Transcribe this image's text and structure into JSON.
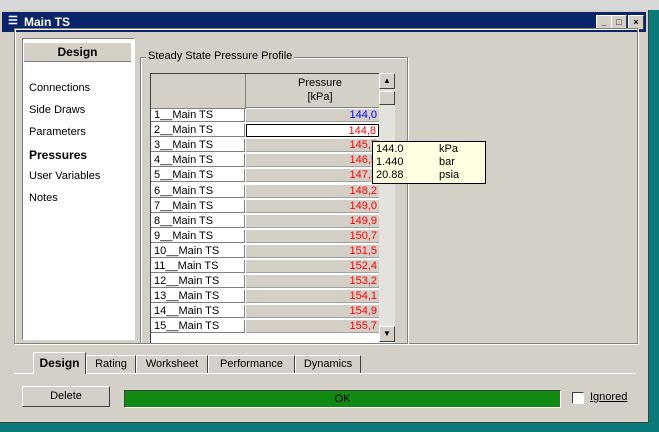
{
  "window": {
    "title": "Main TS",
    "icon_glyph": "☰",
    "minimize_glyph": "_",
    "maximize_glyph": "□",
    "close_glyph": "×"
  },
  "nav": {
    "heading": "Design",
    "items": [
      {
        "label": "Connections",
        "selected": false
      },
      {
        "label": "Side Draws",
        "selected": false
      },
      {
        "label": "Parameters",
        "selected": false
      },
      {
        "label": "Pressures",
        "selected": true
      },
      {
        "label": "User Variables",
        "selected": false
      },
      {
        "label": "Notes",
        "selected": false
      }
    ]
  },
  "profile": {
    "group_label": "Steady State Pressure Profile",
    "column_header": "Pressure",
    "column_unit": "[kPa]",
    "rows": [
      {
        "stage": "1__Main TS",
        "value": "144,0",
        "color": "#0000ff"
      },
      {
        "stage": "2__Main TS",
        "value": "144,8",
        "color": "#ff0000"
      },
      {
        "stage": "3__Main TS",
        "value": "145,7",
        "color": "#ff0000"
      },
      {
        "stage": "4__Main TS",
        "value": "146,5",
        "color": "#ff0000"
      },
      {
        "stage": "5__Main TS",
        "value": "147,3",
        "color": "#ff0000"
      },
      {
        "stage": "6__Main TS",
        "value": "148,2",
        "color": "#ff0000"
      },
      {
        "stage": "7__Main TS",
        "value": "149,0",
        "color": "#ff0000"
      },
      {
        "stage": "8__Main TS",
        "value": "149,9",
        "color": "#ff0000"
      },
      {
        "stage": "9__Main TS",
        "value": "150,7",
        "color": "#ff0000"
      },
      {
        "stage": "10__Main TS",
        "value": "151,5",
        "color": "#ff0000"
      },
      {
        "stage": "11__Main TS",
        "value": "152,4",
        "color": "#ff0000"
      },
      {
        "stage": "12__Main TS",
        "value": "153,2",
        "color": "#ff0000"
      },
      {
        "stage": "13__Main TS",
        "value": "154,1",
        "color": "#ff0000"
      },
      {
        "stage": "14__Main TS",
        "value": "154,9",
        "color": "#ff0000"
      },
      {
        "stage": "15__Main TS",
        "value": "155,7",
        "color": "#ff0000"
      }
    ],
    "selected_row": 1
  },
  "tooltip": {
    "lines": [
      {
        "value": "144.0",
        "unit": "kPa"
      },
      {
        "value": "1.440",
        "unit": "bar"
      },
      {
        "value": "20.88",
        "unit": "psia"
      }
    ]
  },
  "tabs": [
    {
      "label": "Design",
      "active": true
    },
    {
      "label": "Rating",
      "active": false
    },
    {
      "label": "Worksheet",
      "active": false
    },
    {
      "label": "Performance",
      "active": false
    },
    {
      "label": "Dynamics",
      "active": false
    }
  ],
  "footer": {
    "delete_label": "Delete",
    "status_text": "OK",
    "status_color": "#118a11",
    "ignored_label": "Ignored",
    "ignored_checked": false
  }
}
